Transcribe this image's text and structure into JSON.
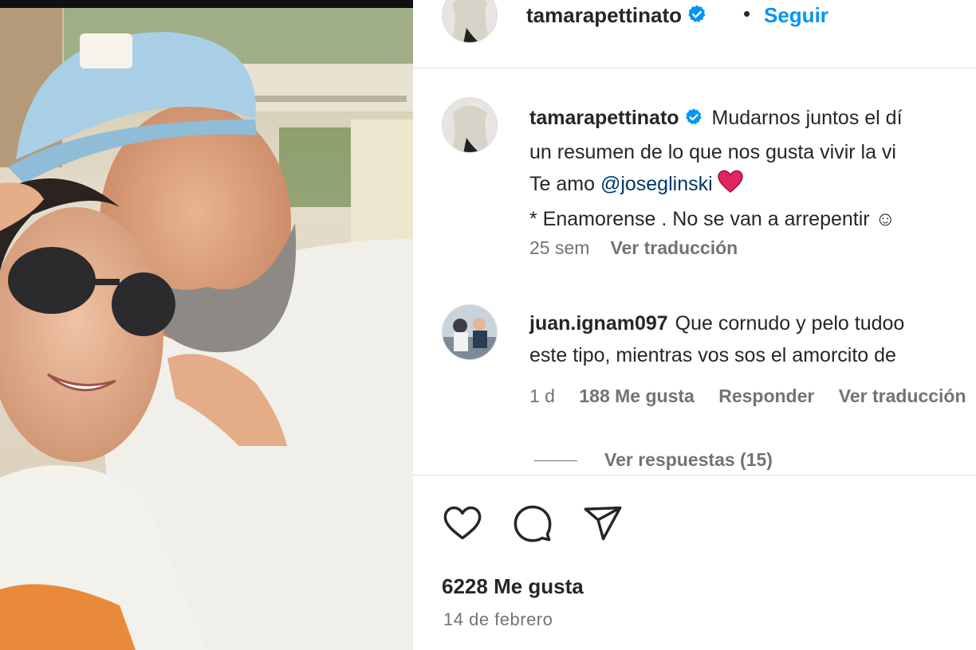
{
  "post": {
    "author": "tamarapettinato",
    "follow_label": "Seguir",
    "separator": "•"
  },
  "caption": {
    "author": "tamarapettinato",
    "line1": "Mudarnos juntos el dí",
    "line2": "un resumen de lo que nos gusta vivir la vi",
    "line3_prefix": "Te amo ",
    "mention": "@joseglinski",
    "line4": "* Enamorense . No se van a arrepentir ☺",
    "age": "25 sem",
    "translate_label": "Ver traducción"
  },
  "comment": {
    "author": "juan.ignam097",
    "line1": "Que cornudo y pelo tudoo",
    "line2": "este tipo, mientras vos sos el amorcito de",
    "age": "1 d",
    "likes": "188 Me gusta",
    "reply_label": "Responder",
    "translate_label": "Ver traducción",
    "view_replies": "Ver respuestas (15)"
  },
  "footer": {
    "likes": "6228 Me gusta",
    "date": "14 de febrero"
  },
  "icons": {
    "verified": "verified-badge-icon",
    "heart_emoji": "red-heart-emoji",
    "like": "heart-icon",
    "comment": "comment-bubble-icon",
    "share": "paper-plane-icon"
  },
  "colors": {
    "accent": "#0095f6",
    "mention": "#00376b",
    "secondary_text": "#737373",
    "verified": "#0095f6",
    "heart": "#e0245e"
  }
}
